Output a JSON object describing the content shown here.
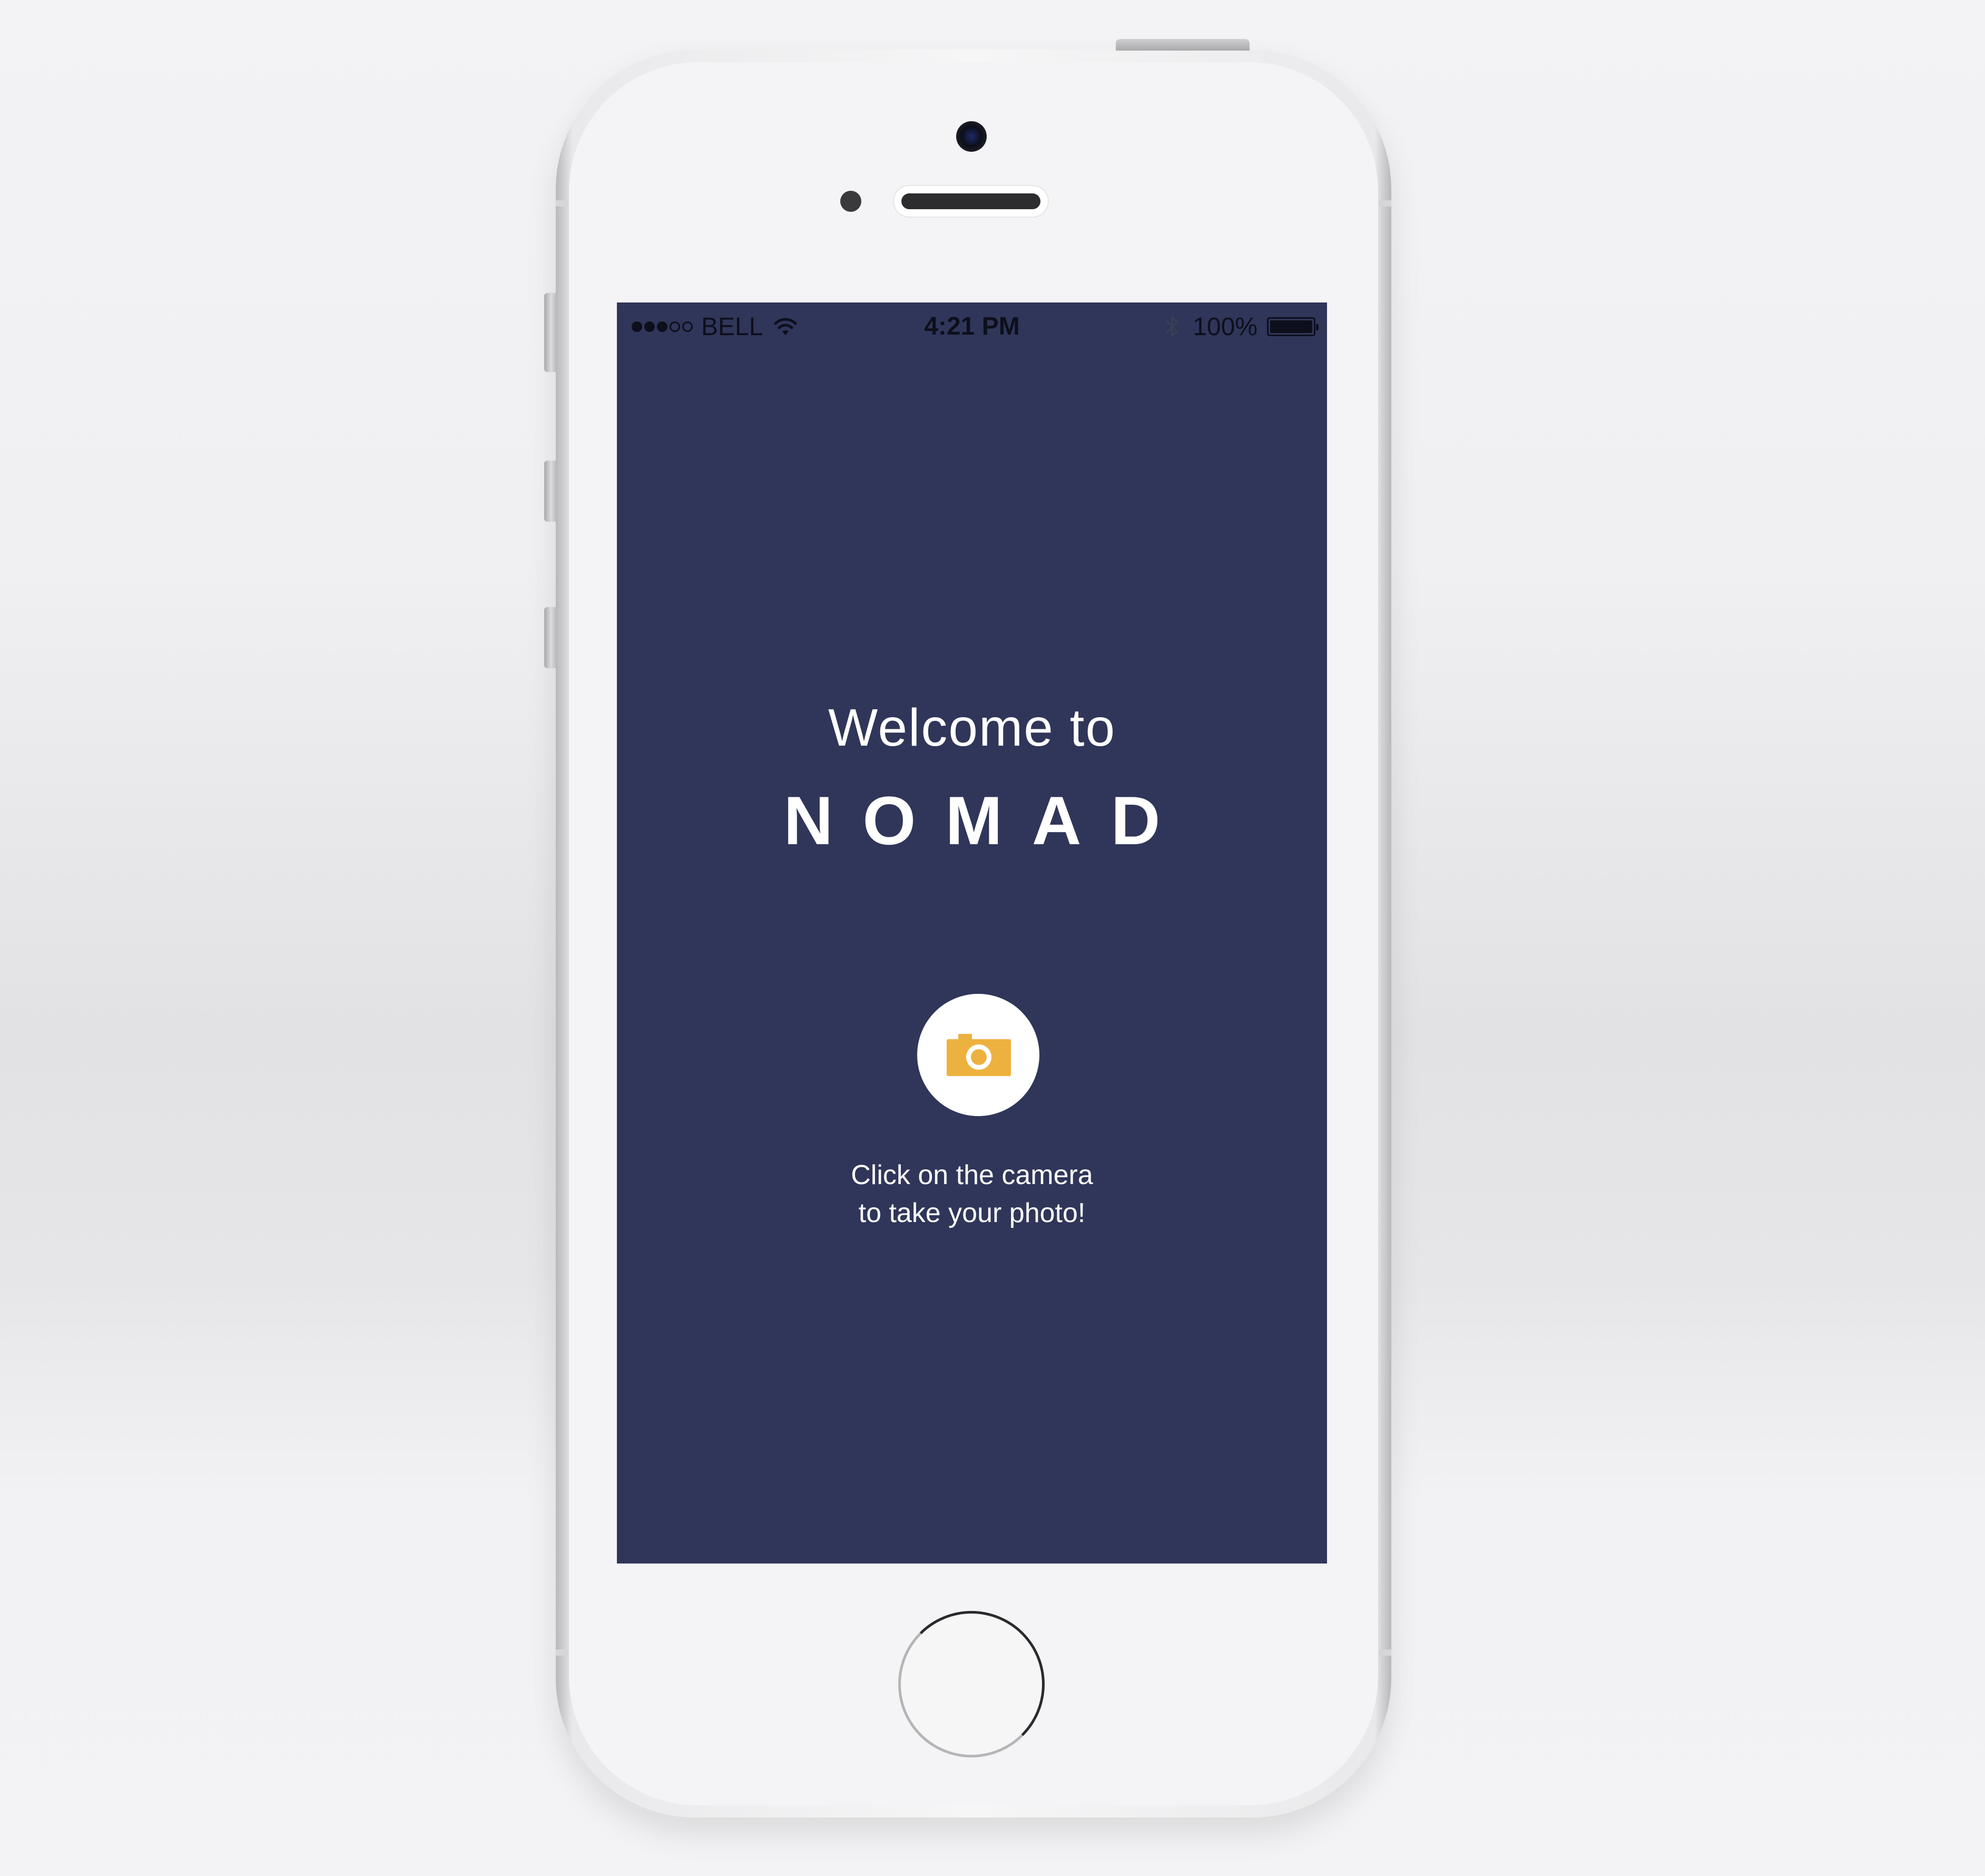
{
  "status_bar": {
    "signal_bars": 5,
    "signal_filled": 3,
    "carrier": "BELL",
    "time": "4:21 PM",
    "battery_percent_text": "100%",
    "battery_level": 1.0,
    "icons": [
      "signal-dots-icon",
      "wifi-icon",
      "bluetooth-icon",
      "battery-icon"
    ]
  },
  "welcome": {
    "greeting": "Welcome to",
    "app_name": "NOMAD"
  },
  "camera": {
    "icon": "camera-icon",
    "hint_line1": "Click on the camera",
    "hint_line2": "to take your photo!"
  },
  "colors": {
    "screen_background": "#303659",
    "camera_accent": "#EDB13F",
    "text": "#FFFFFF",
    "device_body": "#F4F4F6"
  }
}
